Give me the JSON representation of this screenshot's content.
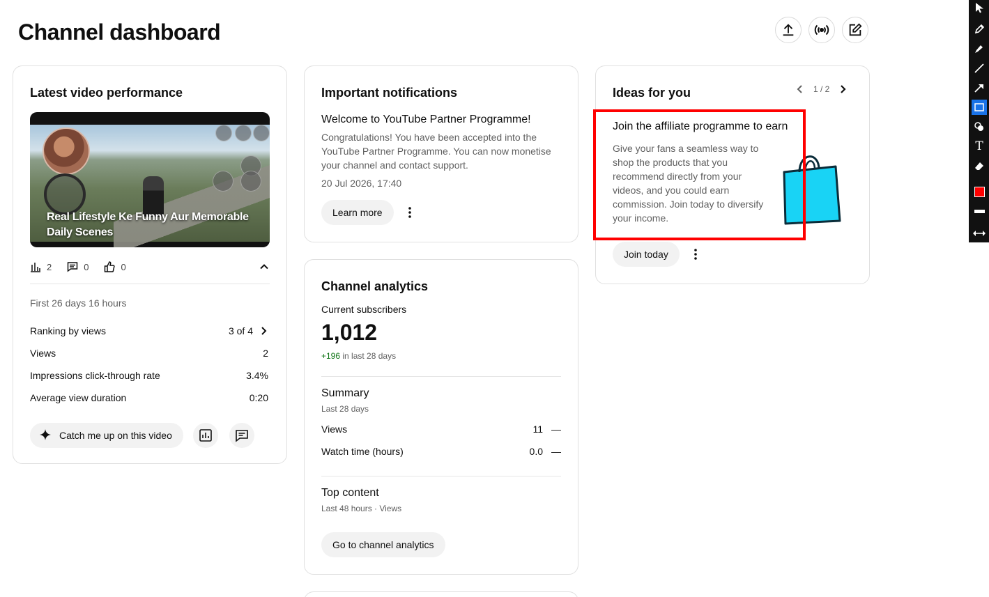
{
  "page": {
    "title": "Channel dashboard"
  },
  "header_actions": {
    "upload_icon": "upload-icon",
    "live_icon": "live-icon",
    "edit_icon": "edit-icon"
  },
  "latest_video": {
    "card_title": "Latest video performance",
    "thumbnail_caption": "Real Lifestyle Ke Funny Aur Memorable Daily Scenes",
    "views_count": "2",
    "comments_count": "0",
    "likes_count": "0",
    "period": "First 26 days 16 hours",
    "metrics": [
      {
        "label": "Ranking by views",
        "value": "3 of 4"
      },
      {
        "label": "Views",
        "value": "2"
      },
      {
        "label": "Impressions click-through rate",
        "value": "3.4%"
      },
      {
        "label": "Average view duration",
        "value": "0:20"
      }
    ],
    "catch_up_label": "Catch me up on this video"
  },
  "notifications": {
    "card_title": "Important notifications",
    "headline": "Welcome to YouTube Partner Programme!",
    "body": "Congratulations! You have been accepted into the YouTube Partner Programme. You can now monetise your channel and contact support.",
    "date": "20 Jul 2026, 17:40",
    "learn_more_label": "Learn more"
  },
  "analytics": {
    "card_title": "Channel analytics",
    "subscribers_label": "Current subscribers",
    "subscribers_value": "1,012",
    "delta_value": "+196",
    "delta_suffix": " in last 28 days",
    "summary_title": "Summary",
    "summary_period": "Last 28 days",
    "rows": [
      {
        "label": "Views",
        "value": "11",
        "trend": "—"
      },
      {
        "label": "Watch time (hours)",
        "value": "0.0",
        "trend": "—"
      }
    ],
    "top_content_title": "Top content",
    "top_content_sub": "Last 48 hours · Views",
    "go_button_label": "Go to channel analytics"
  },
  "ideas": {
    "card_title": "Ideas for you",
    "pager": "1 / 2",
    "idea_title": "Join the affiliate programme to earn",
    "idea_body": "Give your fans a seamless way to shop the products that you recommend directly from your videos, and you could earn commission. Join today to diversify your income.",
    "join_label": "Join today",
    "colors": {
      "bag_fill": "#19d3f5",
      "annotation": "#ff0000"
    }
  },
  "toolbar": {
    "tools": [
      "cursor-icon",
      "pencil-icon",
      "highlighter-icon",
      "line-icon",
      "arrow-icon",
      "rectangle-icon",
      "stamp-icon",
      "text-icon",
      "eraser-icon",
      "color-swatch",
      "stroke-width",
      "resize-icon"
    ],
    "text_tool_glyph": "T",
    "active_color": "#ff0000"
  }
}
